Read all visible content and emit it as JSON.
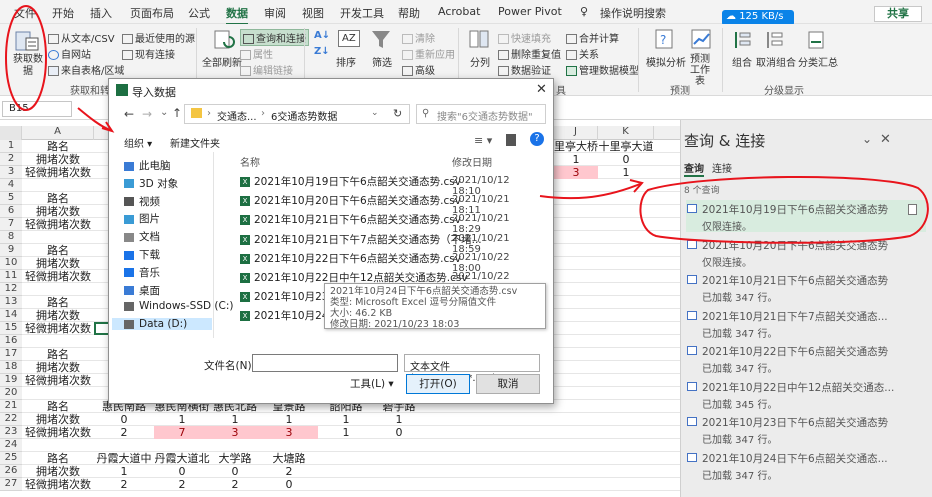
{
  "menubar": {
    "items": [
      "文件",
      "开始",
      "插入",
      "页面布局",
      "公式",
      "数据",
      "审阅",
      "视图",
      "开发工具",
      "帮助",
      "Acrobat",
      "Power Pivot"
    ],
    "active": "数据",
    "tell_me": "操作说明搜索",
    "speed": "125 KB/s",
    "share": "共享"
  },
  "ribbon": {
    "get_data": "获取数据",
    "from_text": "从文本/CSV",
    "from_web": "自网站",
    "from_table": "来自表格/区域",
    "recent_sources": "最近使用的源",
    "existing_conn": "现有连接",
    "refresh_all": "全部刷新",
    "queries_conn": "查询和连接",
    "properties": "属性",
    "edit_links": "编辑链接",
    "sort": "排序",
    "filter": "筛选",
    "clear": "清除",
    "reapply": "重新应用",
    "advanced": "高级",
    "split": "分列",
    "flash_fill": "快速填充",
    "remove_dup": "删除重复值",
    "data_validation": "数据验证",
    "consolidate": "合并计算",
    "relationships": "关系",
    "data_model": "管理数据模型",
    "whatif": "模拟分析",
    "forecast_sheet": "预测工作表",
    "group": "组合",
    "ungroup": "取消组合",
    "subtotal": "分类汇总",
    "grp_get": "获取和转换",
    "grp_tools": "具",
    "grp_forecast": "预测",
    "grp_outline": "分级显示"
  },
  "namebox": "B15",
  "grid": {
    "col_letters": [
      "A",
      "J",
      "K"
    ],
    "rows": [
      {
        "n": "1",
        "a": "路名",
        "b": "长",
        "j": "里亭大桥",
        "k": "十里亭大道"
      },
      {
        "n": "2",
        "a": "拥堵次数",
        "j": "1",
        "k": "0"
      },
      {
        "n": "3",
        "a": "轻微拥堵次数",
        "j": "3",
        "k": "1"
      },
      {
        "n": "4"
      },
      {
        "n": "5",
        "a": "路名",
        "b": "韶"
      },
      {
        "n": "6",
        "a": "拥堵次数"
      },
      {
        "n": "7",
        "a": "轻微拥堵次数"
      },
      {
        "n": "8"
      },
      {
        "n": "9",
        "a": "路名",
        "b": "沐"
      },
      {
        "n": "10",
        "a": "拥堵次数"
      },
      {
        "n": "11",
        "a": "轻微拥堵次数"
      },
      {
        "n": "12"
      },
      {
        "n": "13",
        "a": "路名",
        "b": "和"
      },
      {
        "n": "14",
        "a": "拥堵次数"
      },
      {
        "n": "15",
        "a": "轻微拥堵次数"
      },
      {
        "n": "16"
      },
      {
        "n": "17",
        "a": "路名",
        "b": "前"
      },
      {
        "n": "18",
        "a": "拥堵次数"
      },
      {
        "n": "19",
        "a": "轻微拥堵次数"
      },
      {
        "n": "20"
      },
      {
        "n": "21",
        "a": "路名",
        "b": "惠民南路",
        "c": "惠民南横街",
        "d": "惠民北路",
        "e": "皇景路",
        "f": "韶阳路",
        "g": "碧宇路"
      },
      {
        "n": "22",
        "a": "拥堵次数",
        "b": "0",
        "c": "1",
        "d": "1",
        "e": "1",
        "f": "1",
        "g": "1"
      },
      {
        "n": "23",
        "a": "轻微拥堵次数",
        "b": "2",
        "c": "7",
        "d": "3",
        "e": "3",
        "f": "1",
        "g": "0"
      },
      {
        "n": "24"
      },
      {
        "n": "25",
        "a": "路名",
        "b": "丹霞大道中",
        "c": "丹霞大道北",
        "d": "大学路",
        "e": "大塘路"
      },
      {
        "n": "26",
        "a": "拥堵次数",
        "b": "1",
        "c": "0",
        "d": "0",
        "e": "2"
      },
      {
        "n": "27",
        "a": "轻微拥堵次数",
        "b": "2",
        "c": "2",
        "d": "2",
        "e": "0"
      }
    ]
  },
  "dialog": {
    "title": "导入数据",
    "path": [
      "交通态...",
      "6交通态势数据"
    ],
    "search_placeholder": "搜索\"6交通态势数据\"",
    "organize": "组织 ▾",
    "new_folder": "新建文件夹",
    "nav": [
      "此电脑",
      "3D 对象",
      "视频",
      "图片",
      "文档",
      "下载",
      "音乐",
      "桌面",
      "Windows-SSD (C:)",
      "Data (D:)"
    ],
    "nav_selected": "Data (D:)",
    "col_name": "名称",
    "col_date": "修改日期",
    "files": [
      {
        "name": "2021年10月19日下午6点韶关交通态势.csv",
        "date": "2021/10/12 18:10"
      },
      {
        "name": "2021年10月20日下午6点韶关交通态势.csv",
        "date": "2021/10/21 18:11"
      },
      {
        "name": "2021年10月21日下午6点韶关交通态势.csv",
        "date": "2021/10/21 18:29"
      },
      {
        "name": "2021年10月21日下午7点韶关交通态势（不堵...",
        "date": "2021/10/21 18:59"
      },
      {
        "name": "2021年10月22日下午6点韶关交通态势.csv",
        "date": "2021/10/22 18:00"
      },
      {
        "name": "2021年10月22日中午12点韶关交通态势.csv",
        "date": "2021/10/22 12:11"
      },
      {
        "name": "2021年10月23日下午6点韶关交通态势.csv",
        "date": "2021/10/23 18:03"
      },
      {
        "name": "2021年10月24日下午6点韶关交通态势.csv",
        "date": ""
      }
    ],
    "tooltip": [
      "2021年10月24日下午6点韶关交通态势.csv",
      "类型: Microsoft Excel 逗号分隔值文件",
      "大小: 46.2 KB",
      "修改日期: 2021/10/23 18:03"
    ],
    "filename_label": "文件名(N):",
    "filename_value": "",
    "filetype": "文本文件(*.prn;*.txt;*.csv)",
    "tools": "工具(L) ▾",
    "open": "打开(O)",
    "cancel": "取消"
  },
  "queries": {
    "title": "查询 & 连接",
    "tab_queries": "查询",
    "tab_connections": "连接",
    "count": "8 个查询",
    "items": [
      {
        "name": "2021年10月19日下午6点韶关交通态势",
        "status": "仅限连接。"
      },
      {
        "name": "2021年10月20日下午6点韶关交通态势",
        "status": "仅限连接。"
      },
      {
        "name": "2021年10月21日下午6点韶关交通态势",
        "status": "已加载 347 行。"
      },
      {
        "name": "2021年10月21日下午7点韶关交通态...",
        "status": "已加载 347 行。"
      },
      {
        "name": "2021年10月22日下午6点韶关交通态势",
        "status": "已加载 347 行。"
      },
      {
        "name": "2021年10月22日中午12点韶关交通态...",
        "status": "已加载 345 行。"
      },
      {
        "name": "2021年10月23日下午6点韶关交通态势",
        "status": "已加载 347 行。"
      },
      {
        "name": "2021年10月24日下午6点韶关交通态...",
        "status": "已加载 347 行。"
      }
    ]
  },
  "colors": {
    "accent": "#217346",
    "annotation": "#e8141c",
    "pink": "#ffc7ce",
    "selected_query": "#d8ecdf"
  }
}
